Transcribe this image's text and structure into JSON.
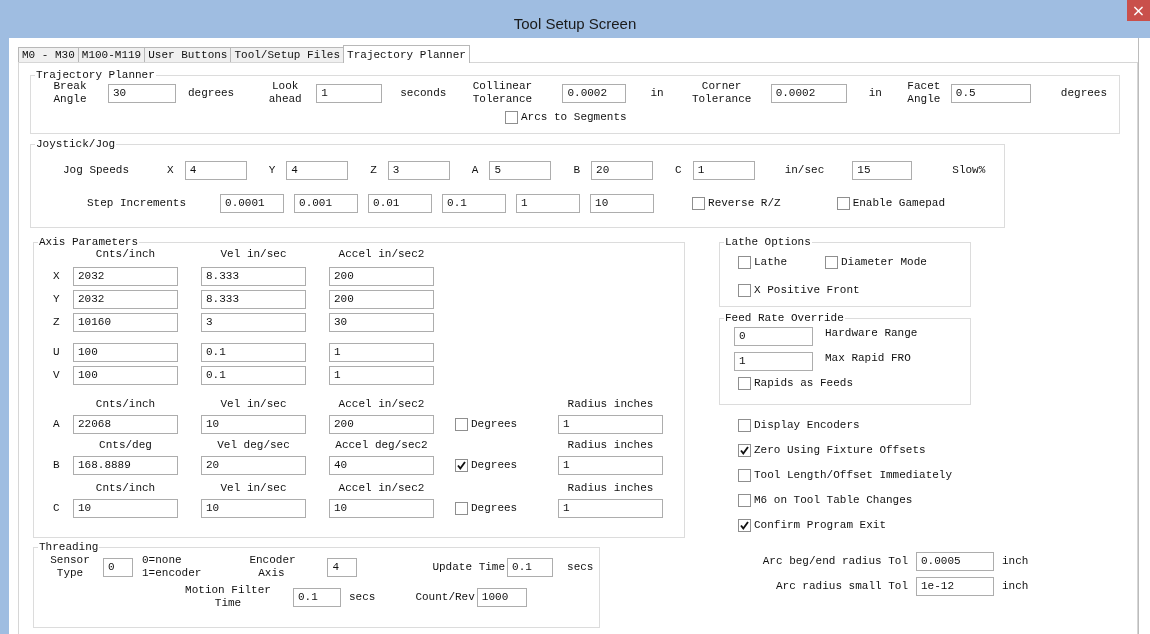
{
  "window": {
    "title": "Tool Setup Screen",
    "close": "×"
  },
  "tabs": [
    {
      "label": "M0 - M30",
      "selected": false
    },
    {
      "label": "M100-M119",
      "selected": false
    },
    {
      "label": "User Buttons",
      "selected": false
    },
    {
      "label": "Tool/Setup Files",
      "selected": false
    },
    {
      "label": "Trajectory Planner",
      "selected": true
    }
  ],
  "trajectory_planner": {
    "title": "Trajectory Planner",
    "fields": [
      {
        "label": "Break Angle",
        "value": "30",
        "unit": "degrees"
      },
      {
        "label": "Look ahead",
        "value": "1",
        "unit": "seconds"
      },
      {
        "label": "Collinear Tolerance",
        "value": "0.0002",
        "unit": "in"
      },
      {
        "label": "Corner Tolerance",
        "value": "0.0002",
        "unit": "in"
      },
      {
        "label": "Facet Angle",
        "value": "0.5",
        "unit": "degrees"
      }
    ],
    "arcs_to_segments": {
      "label": "Arcs to Segments",
      "checked": false
    }
  },
  "joystick_jog": {
    "title": "Joystick/Jog",
    "jog_speeds": {
      "label": "Jog Speeds",
      "axes": [
        {
          "axis": "X",
          "value": "4"
        },
        {
          "axis": "Y",
          "value": "4"
        },
        {
          "axis": "Z",
          "value": "3"
        },
        {
          "axis": "A",
          "value": "5"
        },
        {
          "axis": "B",
          "value": "20"
        },
        {
          "axis": "C",
          "value": "1"
        }
      ],
      "unit": "in/sec",
      "slow_value": "15",
      "slow_label": "Slow%"
    },
    "step_increments": {
      "label": "Step Increments",
      "values": [
        "0.0001",
        "0.001",
        "0.01",
        "0.1",
        "1",
        "10"
      ]
    },
    "options": [
      {
        "label": "Reverse R/Z",
        "checked": false
      },
      {
        "label": "Enable Gamepad",
        "checked": false
      }
    ]
  },
  "axis_parameters": {
    "title": "Axis Parameters",
    "sections": [
      {
        "columns": [
          "Cnts/inch",
          "Vel in/sec",
          "Accel in/sec2"
        ],
        "rows": [
          {
            "axis": "X",
            "values": [
              "2032",
              "8.333",
              "200"
            ]
          },
          {
            "axis": "Y",
            "values": [
              "2032",
              "8.333",
              "200"
            ]
          },
          {
            "axis": "Z",
            "values": [
              "10160",
              "3",
              "30"
            ]
          },
          {
            "axis": "U",
            "values": [
              "100",
              "0.1",
              "1"
            ]
          },
          {
            "axis": "V",
            "values": [
              "100",
              "0.1",
              "1"
            ]
          }
        ]
      },
      {
        "columns": [
          "Cnts/inch",
          "Vel in/sec",
          "Accel in/sec2",
          "Radius inches"
        ],
        "rows": [
          {
            "axis": "A",
            "values": [
              "22068",
              "10",
              "200"
            ],
            "degrees": {
              "label": "Degrees",
              "checked": false
            },
            "radius": "1"
          }
        ]
      },
      {
        "columns": [
          "Cnts/deg",
          "Vel deg/sec",
          "Accel deg/sec2",
          "Radius inches"
        ],
        "rows": [
          {
            "axis": "B",
            "values": [
              "168.8889",
              "20",
              "40"
            ],
            "degrees": {
              "label": "Degrees",
              "checked": true
            },
            "radius": "1"
          }
        ]
      },
      {
        "columns": [
          "Cnts/inch",
          "Vel in/sec",
          "Accel in/sec2",
          "Radius inches"
        ],
        "rows": [
          {
            "axis": "C",
            "values": [
              "10",
              "10",
              "10"
            ],
            "degrees": {
              "label": "Degrees",
              "checked": false
            },
            "radius": "1"
          }
        ]
      }
    ]
  },
  "threading": {
    "title": "Threading",
    "sensor_type": {
      "label": "Sensor Type",
      "value": "0",
      "legend": [
        "0=none",
        "1=encoder"
      ]
    },
    "encoder_axis": {
      "label": "Encoder Axis",
      "value": "4"
    },
    "update_time": {
      "label": "Update Time",
      "value": "0.1",
      "unit": "secs"
    },
    "motion_filter_time": {
      "label": "Motion Filter Time",
      "value": "0.1",
      "unit": "secs"
    },
    "count_rev": {
      "label": "Count/Rev",
      "value": "1000"
    }
  },
  "lathe_options": {
    "title": "Lathe Options",
    "options": [
      {
        "label": "Lathe",
        "checked": false
      },
      {
        "label": "Diameter Mode",
        "checked": false
      },
      {
        "label": "X Positive Front",
        "checked": false
      }
    ]
  },
  "feed_rate_override": {
    "title": "Feed Rate Override",
    "fields": [
      {
        "value": "0",
        "label": "Hardware Range"
      },
      {
        "value": "1",
        "label": "Max Rapid FRO"
      }
    ],
    "rapids_as_feeds": {
      "label": "Rapids as Feeds",
      "checked": false
    }
  },
  "options": [
    {
      "label": "Display Encoders",
      "checked": false
    },
    {
      "label": "Zero Using Fixture Offsets",
      "checked": true
    },
    {
      "label": "Tool Length/Offset Immediately",
      "checked": false
    },
    {
      "label": "M6 on Tool Table Changes",
      "checked": false
    },
    {
      "label": "Confirm Program Exit",
      "checked": true
    }
  ],
  "arc_tolerances": [
    {
      "label": "Arc beg/end radius Tol",
      "value": "0.0005",
      "unit": "inch"
    },
    {
      "label": "Arc radius small Tol",
      "value": "1e-12",
      "unit": "inch"
    }
  ]
}
